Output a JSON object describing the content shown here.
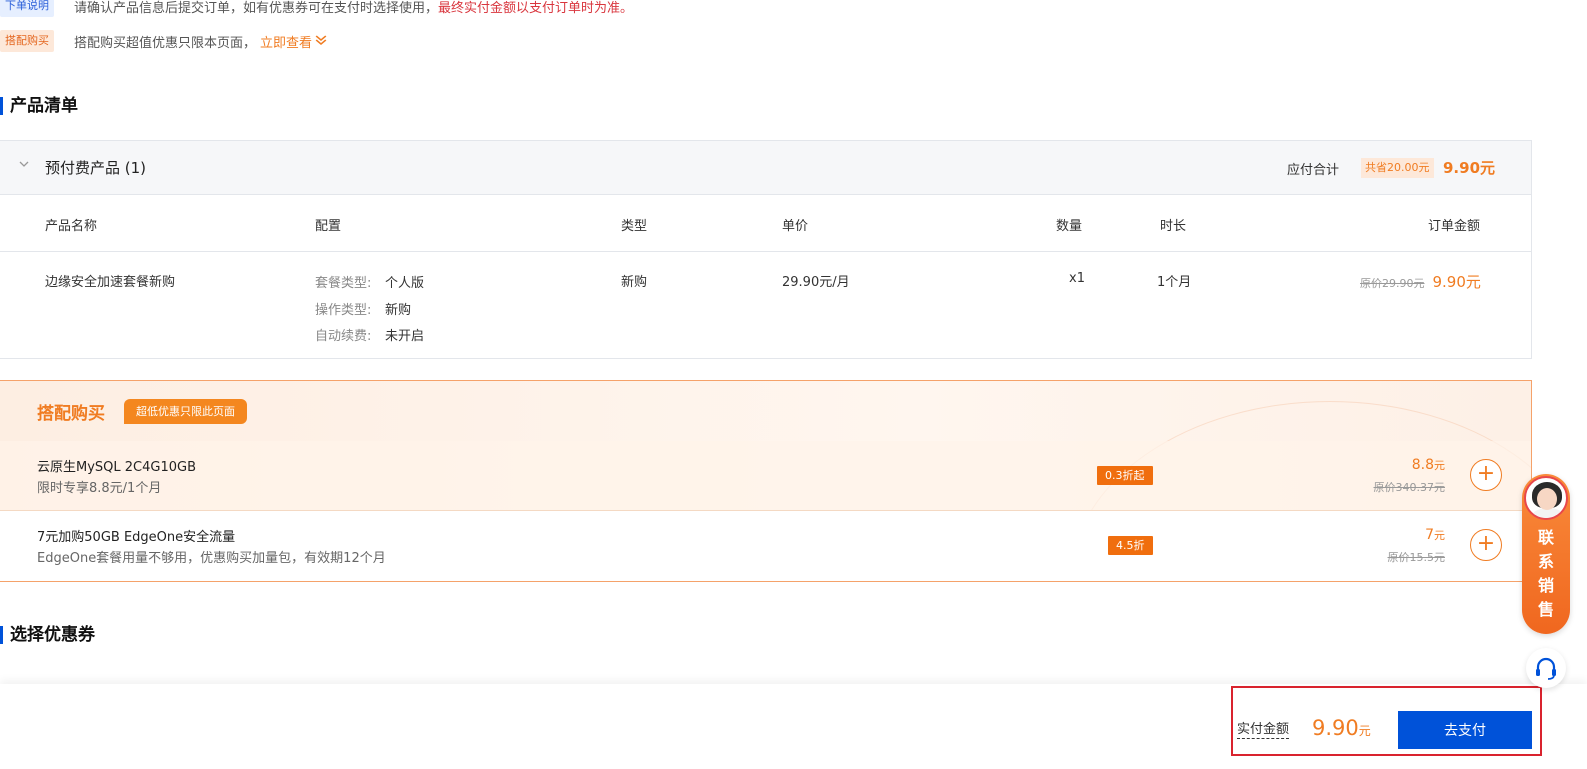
{
  "notices": {
    "order_tag": "下单说明",
    "order_text": "请确认产品信息后提交订单，如有优惠券可在支付时选择使用，",
    "order_text_red": "最终实付金额以支付订单时为准。",
    "combo_tag": "搭配购买",
    "combo_text": "搭配购买超值优惠只限本页面，",
    "combo_link": "立即查看"
  },
  "product_section": {
    "title": "产品清单",
    "group_title": "预付费产品 (1)",
    "sum_label": "应付合计",
    "save_badge": "共省20.00元",
    "sum_price": "9.90元",
    "columns": [
      "产品名称",
      "配置",
      "类型",
      "单价",
      "数量",
      "时长",
      "订单金额"
    ],
    "row": {
      "name": "边缘安全加速套餐新购",
      "config": [
        {
          "label": "套餐类型:",
          "value": "个人版"
        },
        {
          "label": "操作类型:",
          "value": "新购"
        },
        {
          "label": "自动续费:",
          "value": "未开启"
        }
      ],
      "type": "新购",
      "unit_price": "29.90元/月",
      "quantity": "x1",
      "duration": "1个月",
      "original_price": "原价29.90元",
      "price": "9.90元"
    }
  },
  "combo_section": {
    "title": "搭配购买",
    "badge": "超低优惠只限此页面",
    "items": [
      {
        "name": "云原生MySQL 2C4G10GB",
        "desc": "限时专享8.8元/1个月",
        "discount": "0.3折起",
        "price": "8.8",
        "unit": "元",
        "original": "原价340.37元"
      },
      {
        "name": "7元加购50GB EdgeOne安全流量",
        "desc": "EdgeOne套餐用量不够用，优惠购买加量包，有效期12个月",
        "discount": "4.5折",
        "price": "7",
        "unit": "元",
        "original": "原价15.5元"
      }
    ],
    "add_symbol": "+"
  },
  "coupon_section": {
    "title": "选择优惠券"
  },
  "footer": {
    "pay_label": "实付金额",
    "pay_amount": "9.90",
    "pay_unit": "元",
    "pay_button": "去支付"
  },
  "float": {
    "sales_text": [
      "联",
      "系",
      "销",
      "售"
    ]
  },
  "colors": {
    "accent_orange": "#f07c22",
    "primary_blue": "#0052d9",
    "highlight_red": "#d9232e"
  },
  "icons": {
    "group_toggle": "chevron-down-icon",
    "combo_link": "double-chevron-down-icon",
    "add": "plus-circle-icon",
    "support": "headset-icon",
    "sales": "avatar"
  }
}
